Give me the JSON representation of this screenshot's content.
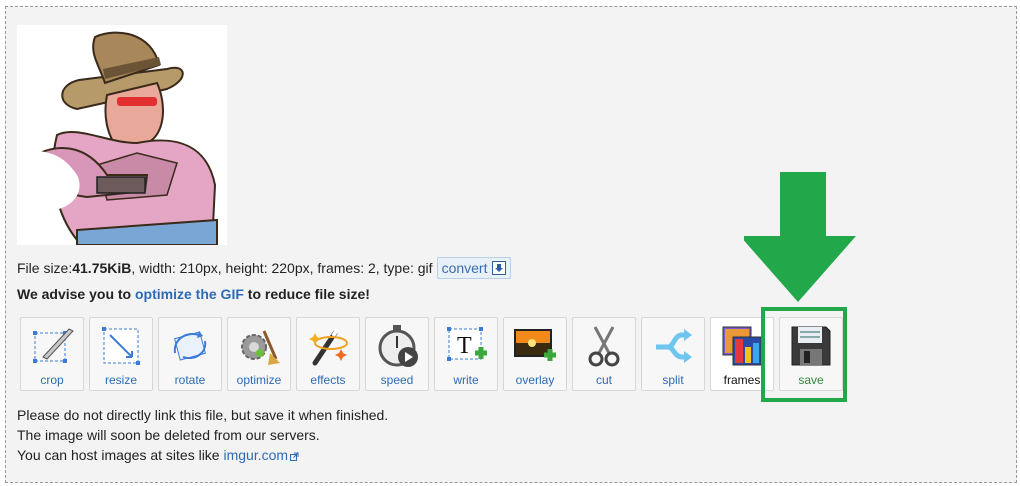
{
  "file_info": {
    "prefix": "File size: ",
    "size": "41.75KiB",
    "details": ", width: 210px, height: 220px, frames: 2, type: gif",
    "convert_label": "convert"
  },
  "advice": {
    "before": "We advise you to ",
    "link": "optimize the GIF",
    "after": " to reduce file size!"
  },
  "tools": [
    {
      "label": "crop",
      "icon": "crop-icon"
    },
    {
      "label": "resize",
      "icon": "resize-icon"
    },
    {
      "label": "rotate",
      "icon": "rotate-icon"
    },
    {
      "label": "optimize",
      "icon": "optimize-icon"
    },
    {
      "label": "effects",
      "icon": "effects-icon"
    },
    {
      "label": "speed",
      "icon": "speed-icon"
    },
    {
      "label": "write",
      "icon": "write-icon"
    },
    {
      "label": "overlay",
      "icon": "overlay-icon"
    },
    {
      "label": "cut",
      "icon": "scissors-icon"
    },
    {
      "label": "split",
      "icon": "split-icon"
    },
    {
      "label": "frames",
      "icon": "frames-icon"
    },
    {
      "label": "save",
      "icon": "floppy-disk-icon"
    }
  ],
  "notes": {
    "line1": "Please do not directly link this file, but save it when finished.",
    "line2": "The image will soon be deleted from our servers.",
    "line3_prefix": "You can host images at sites like ",
    "line3_link": "imgur.com"
  },
  "colors": {
    "highlight": "#22a84a",
    "link": "#2d6bb6"
  }
}
